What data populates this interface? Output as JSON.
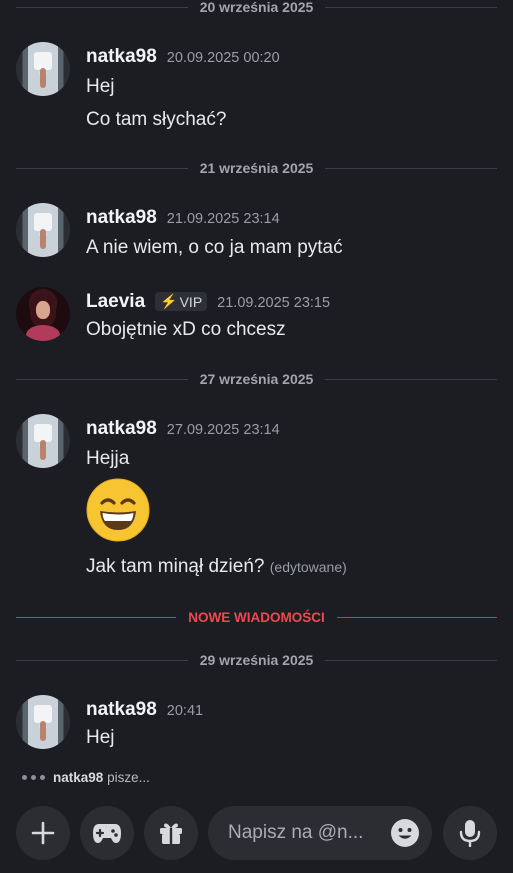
{
  "dividers": {
    "d1": "20 września 2025",
    "d2": "21 września 2025",
    "d3": "27 września 2025",
    "new": "NOWE WIADOMOŚCI",
    "d4": "29 września 2025"
  },
  "messages": {
    "m1": {
      "author": "natka98",
      "time": "20.09.2025 00:20",
      "lines": [
        "Hej",
        "Co tam słychać?"
      ]
    },
    "m2": {
      "author": "natka98",
      "time": "21.09.2025 23:14",
      "lines": [
        "A nie wiem, o co ja mam pytać"
      ]
    },
    "m3": {
      "author": "Laevia",
      "badge": "VIP",
      "time": "21.09.2025 23:15",
      "lines": [
        "Obojętnie xD co chcesz"
      ]
    },
    "m4": {
      "author": "natka98",
      "time": "27.09.2025 23:14",
      "lines": [
        "Hejja",
        "Jak tam minął dzień?"
      ],
      "edited": "(edytowane)",
      "emoji": "grinning-squinting-face"
    },
    "m5": {
      "author": "natka98",
      "time": "20:41",
      "lines": [
        "Hej"
      ]
    }
  },
  "typing": {
    "user": "natka98",
    "text": "pisze..."
  },
  "composer": {
    "placeholder": "Napisz na @n...",
    "icons": [
      "plus-icon",
      "gamepad-icon",
      "gift-icon",
      "emoji-icon",
      "microphone-icon"
    ]
  },
  "colors": {
    "background": "#1c1d22",
    "new_messages": "#ec4a4f",
    "badge_bolt": "#f5c518"
  }
}
